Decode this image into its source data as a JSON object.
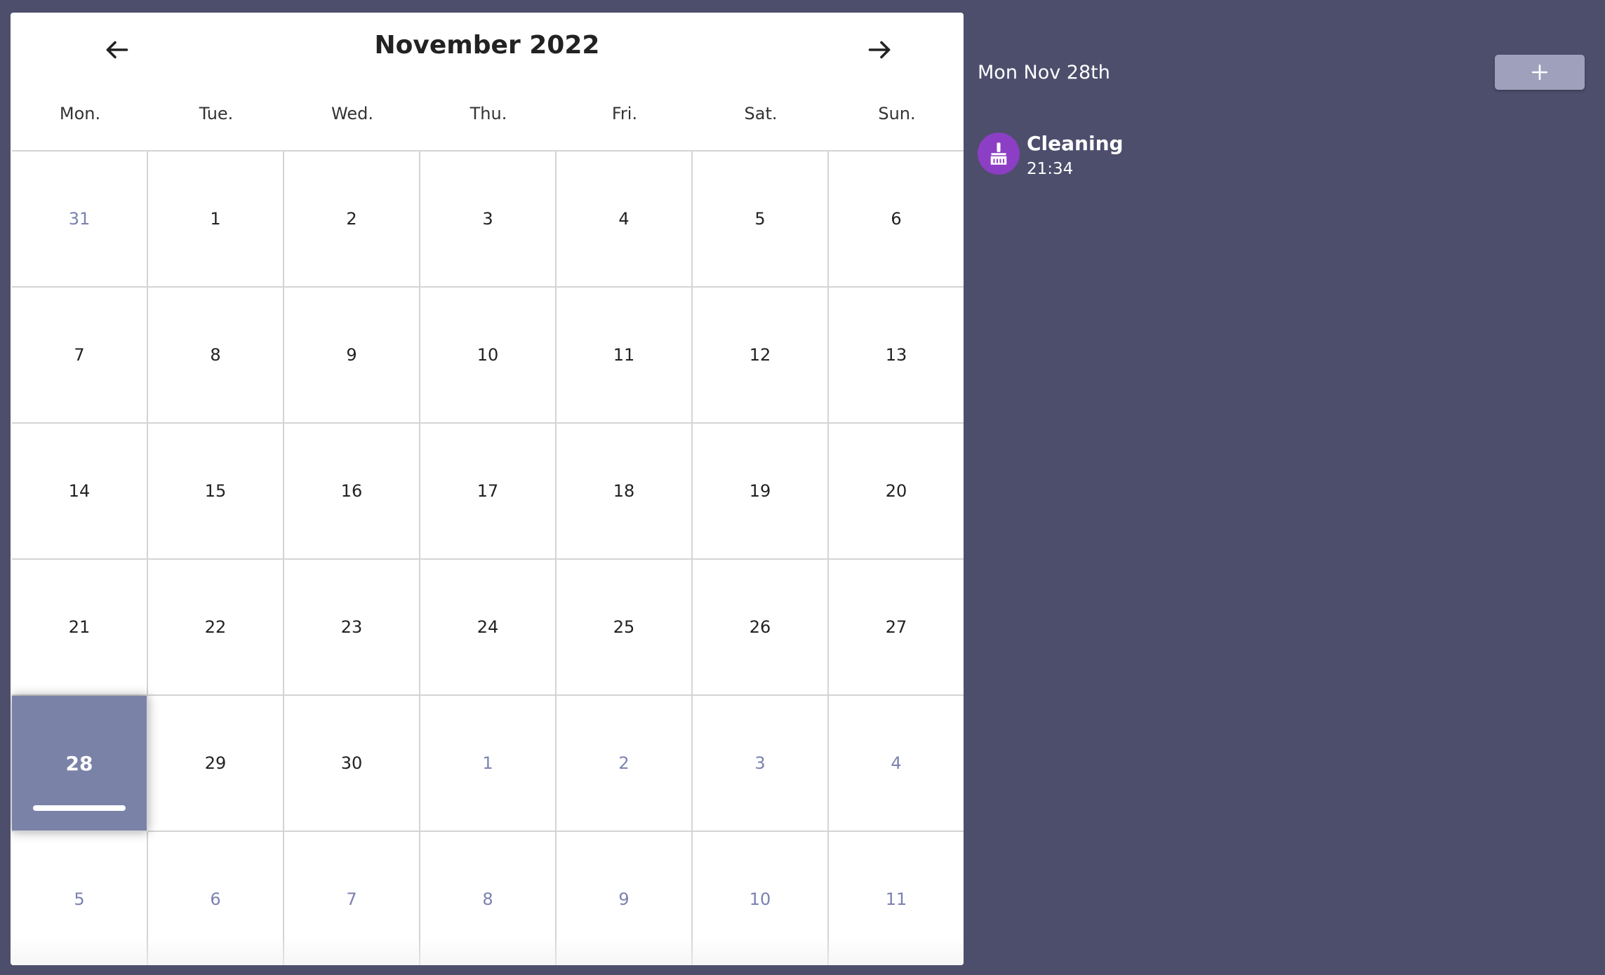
{
  "calendar": {
    "month_title": "November 2022",
    "weekdays": [
      "Mon.",
      "Tue.",
      "Wed.",
      "Thu.",
      "Fri.",
      "Sat.",
      "Sun."
    ],
    "weeks": [
      [
        {
          "day": "31",
          "other": true
        },
        {
          "day": "1"
        },
        {
          "day": "2"
        },
        {
          "day": "3"
        },
        {
          "day": "4"
        },
        {
          "day": "5"
        },
        {
          "day": "6"
        }
      ],
      [
        {
          "day": "7"
        },
        {
          "day": "8"
        },
        {
          "day": "9"
        },
        {
          "day": "10"
        },
        {
          "day": "11"
        },
        {
          "day": "12"
        },
        {
          "day": "13"
        }
      ],
      [
        {
          "day": "14"
        },
        {
          "day": "15"
        },
        {
          "day": "16"
        },
        {
          "day": "17"
        },
        {
          "day": "18"
        },
        {
          "day": "19"
        },
        {
          "day": "20"
        }
      ],
      [
        {
          "day": "21"
        },
        {
          "day": "22"
        },
        {
          "day": "23"
        },
        {
          "day": "24"
        },
        {
          "day": "25"
        },
        {
          "day": "26"
        },
        {
          "day": "27"
        }
      ],
      [
        {
          "day": "28",
          "selected": true,
          "has_event": true
        },
        {
          "day": "29"
        },
        {
          "day": "30"
        },
        {
          "day": "1",
          "other": true
        },
        {
          "day": "2",
          "other": true
        },
        {
          "day": "3",
          "other": true
        },
        {
          "day": "4",
          "other": true
        }
      ],
      [
        {
          "day": "5",
          "other": true
        },
        {
          "day": "6",
          "other": true
        },
        {
          "day": "7",
          "other": true
        },
        {
          "day": "8",
          "other": true
        },
        {
          "day": "9",
          "other": true
        },
        {
          "day": "10",
          "other": true
        },
        {
          "day": "11",
          "other": true
        }
      ]
    ],
    "prev_icon": "arrow-left-icon",
    "next_icon": "arrow-right-icon"
  },
  "side_panel": {
    "selected_date": "Mon Nov 28th",
    "add_icon": "plus-icon",
    "events": [
      {
        "title": "Cleaning",
        "time": "21:34",
        "icon": "broom-icon",
        "color": "#8c3ec4"
      }
    ]
  },
  "colors": {
    "background": "#4d4e6c",
    "selected_day": "#7b82a8",
    "other_month_text": "#7b82b0",
    "add_button": "#9ea0bc"
  }
}
